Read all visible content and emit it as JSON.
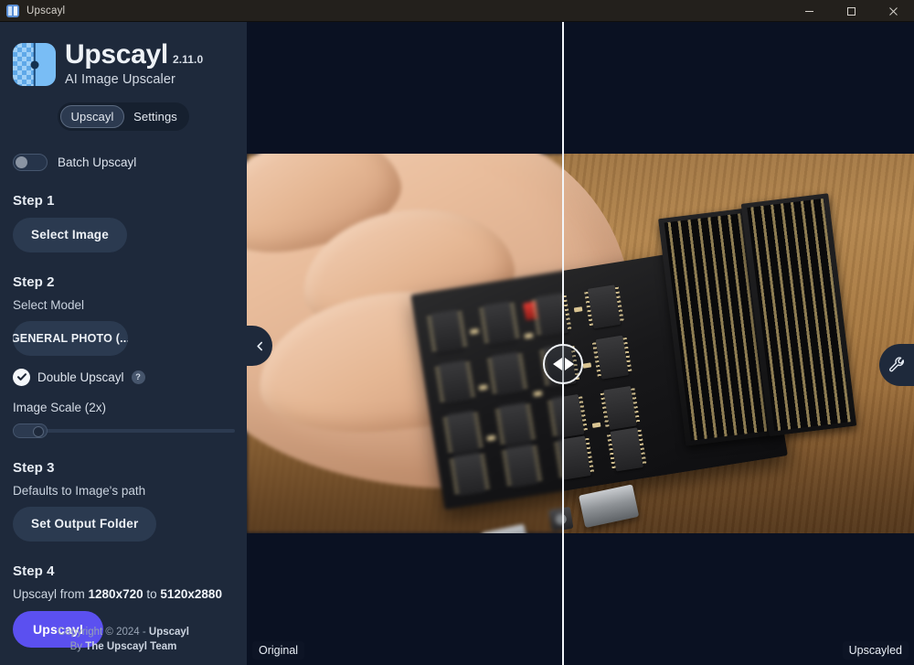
{
  "titlebar": {
    "app_name": "Upscayl",
    "icon": "upscayl-app-icon",
    "minimize": "minimize-icon",
    "maximize": "maximize-icon",
    "close": "close-icon"
  },
  "sidebar": {
    "brand": {
      "title": "Upscayl",
      "version": "2.11.0",
      "subtitle": "AI Image Upscaler",
      "logo": "upscayl-logo"
    },
    "tabs": [
      {
        "label": "Upscayl",
        "active": true
      },
      {
        "label": "Settings",
        "active": false
      }
    ],
    "batch": {
      "label": "Batch Upscayl",
      "enabled": false
    },
    "step1": {
      "heading": "Step 1",
      "select_image_button": "Select Image"
    },
    "step2": {
      "heading": "Step 2",
      "select_model_label": "Select Model",
      "model_value": "GENERAL PHOTO (...",
      "double_upscayl_label": "Double Upscayl",
      "double_upscayl_checked": true,
      "help_badge": "?",
      "image_scale_label": "Image Scale (2x)",
      "slider_value": 0
    },
    "step3": {
      "heading": "Step 3",
      "output_hint": "Defaults to Image's path",
      "set_output_button": "Set Output Folder"
    },
    "step4": {
      "heading": "Step 4",
      "from_prefix": "Upscayl from ",
      "from_resolution": "1280x720",
      "to_word": " to ",
      "to_resolution": "5120x2880",
      "upscayl_button": "Upscayl"
    },
    "footer": {
      "line1_prefix": "Copyright © 2024 - ",
      "line1_brand": "Upscayl",
      "line2_prefix": "By ",
      "line2_brand": "The Upscayl Team"
    }
  },
  "viewer": {
    "left_badge": "Original",
    "right_badge": "Upscayled",
    "collapse_tab_icon": "chevron-left-icon",
    "tools_tab_icon": "wrench-icon",
    "slider_handle_icon": "left-right-arrows-icon",
    "slider_position_percent": 47
  },
  "colors": {
    "accent": "#5b50f0",
    "sidebar_bg": "#1e293b",
    "viewer_bg": "#0a1122",
    "titlebar_bg": "#23201c",
    "divider": "#f3f6fa"
  }
}
